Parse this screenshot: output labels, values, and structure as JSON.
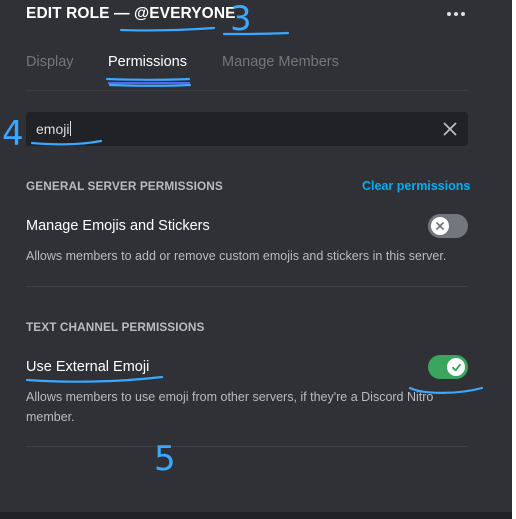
{
  "header": {
    "title": "EDIT ROLE — @EVERYONE"
  },
  "tabs": [
    {
      "label": "Display"
    },
    {
      "label": "Permissions"
    },
    {
      "label": "Manage Members"
    }
  ],
  "search": {
    "value": "emoji"
  },
  "sections": [
    {
      "header": "GENERAL SERVER PERMISSIONS",
      "action_label": "Clear permissions",
      "permissions": [
        {
          "title": "Manage Emojis and Stickers",
          "description": "Allows members to add or remove custom emojis and stickers in this server.",
          "enabled": false
        }
      ]
    },
    {
      "header": "TEXT CHANNEL PERMISSIONS",
      "permissions": [
        {
          "title": "Use External Emoji",
          "description": "Allows members to use emoji from other servers, if they're a Discord Nitro member.",
          "enabled": true
        }
      ]
    }
  ],
  "annotations": {
    "numbers": [
      "3",
      "4",
      "5"
    ],
    "pen_color": "#3aa8ff"
  },
  "colors": {
    "background": "#2f3136",
    "accent": "#5865f2",
    "link": "#00aff4",
    "toggle_on": "#3ba55d",
    "toggle_off": "#72767d"
  }
}
